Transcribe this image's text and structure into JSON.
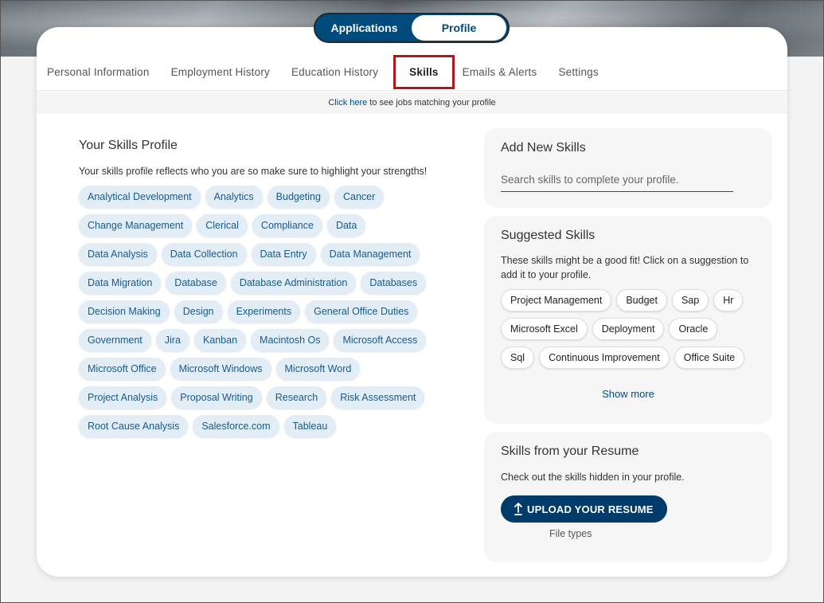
{
  "toggle": {
    "applications": "Applications",
    "profile": "Profile"
  },
  "tabs": [
    "Personal Information",
    "Employment History",
    "Education History",
    "Skills",
    "Emails & Alerts",
    "Settings"
  ],
  "active_tab_index": 3,
  "banner": {
    "link": "Click here",
    "text": "to see jobs matching your profile"
  },
  "skills_profile": {
    "title": "Your Skills Profile",
    "description": "Your skills profile reflects who you are so make sure to highlight your strengths!",
    "skills": [
      "Analytical Development",
      "Analytics",
      "Budgeting",
      "Cancer",
      "Change Management",
      "Clerical",
      "Compliance",
      "Data",
      "Data Analysis",
      "Data Collection",
      "Data Entry",
      "Data Management",
      "Data Migration",
      "Database",
      "Database Administration",
      "Databases",
      "Decision Making",
      "Design",
      "Experiments",
      "General Office Duties",
      "Government",
      "Jira",
      "Kanban",
      "Macintosh Os",
      "Microsoft Access",
      "Microsoft Office",
      "Microsoft Windows",
      "Microsoft Word",
      "Project Analysis",
      "Proposal Writing",
      "Research",
      "Risk Assessment",
      "Root Cause Analysis",
      "Salesforce.com",
      "Tableau"
    ]
  },
  "add_skills": {
    "title": "Add New Skills",
    "placeholder": "Search skills to complete your profile.",
    "value": ""
  },
  "suggested": {
    "title": "Suggested Skills",
    "description": "These skills might be a good fit! Click on a suggestion to add it to your profile.",
    "skills": [
      "Project Management",
      "Budget",
      "Sap",
      "Hr",
      "Microsoft Excel",
      "Deployment",
      "Oracle",
      "Sql",
      "Continuous Improvement",
      "Office Suite"
    ],
    "show_more": "Show more"
  },
  "resume": {
    "title": "Skills from your Resume",
    "description": "Check out the skills hidden in your profile.",
    "upload_label": "UPLOAD YOUR RESUME",
    "file_types": "File types"
  },
  "colors": {
    "primary": "#004a7c",
    "active_tab_border": "#b3171c",
    "chip_bg": "#e3edf6"
  }
}
